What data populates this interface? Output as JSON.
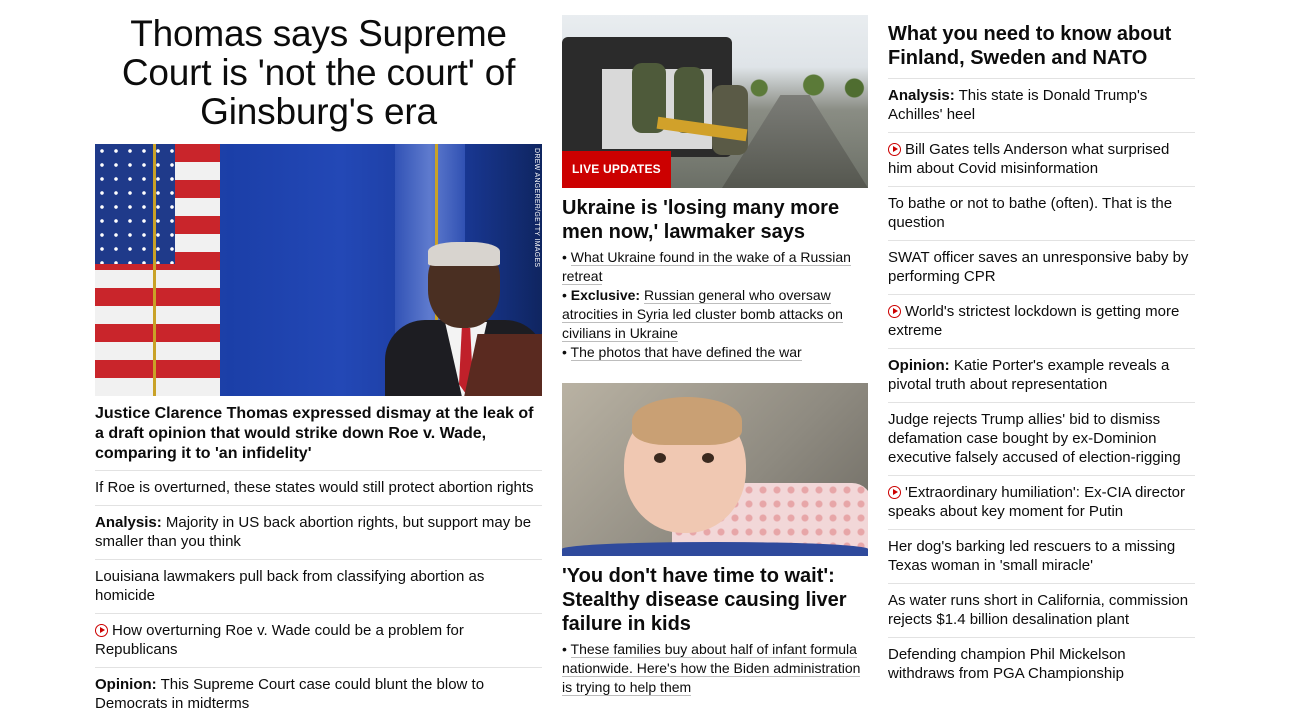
{
  "left": {
    "headline": "Thomas says Supreme Court is 'not the court' of Ginsburg's era",
    "image_credit": "DREW ANGERER/GETTY IMAGES",
    "caption": "Justice Clarence Thomas expressed dismay at the leak of a draft opinion that would strike down Roe v. Wade, comparing it to 'an infidelity'",
    "items": [
      {
        "prefix": "",
        "text": "If Roe is overturned, these states would still protect abortion rights"
      },
      {
        "prefix": "Analysis:",
        "text": "Majority in US back abortion rights, but support may be smaller than you think"
      },
      {
        "prefix": "",
        "text": "Louisiana lawmakers pull back from classifying abortion as homicide"
      },
      {
        "prefix": "",
        "text": "How overturning Roe v. Wade could be a problem for Republicans"
      },
      {
        "prefix": "Opinion:",
        "text": "This Supreme Court case could blunt the blow to Democrats in midterms"
      }
    ]
  },
  "middle": {
    "live_badge": "LIVE UPDATES",
    "story1": {
      "headline": "Ukraine is 'losing many more men now,' lawmaker says",
      "bullets": [
        {
          "prefix": "",
          "text": "What Ukraine found in the wake of a Russian retreat"
        },
        {
          "prefix": "Exclusive:",
          "text": "Russian general who oversaw atrocities in Syria led cluster bomb attacks on civilians in Ukraine"
        },
        {
          "prefix": "",
          "text": "The photos that have defined the war"
        }
      ]
    },
    "story2": {
      "headline": "'You don't have time to wait': Stealthy disease causing liver failure in kids",
      "bullets": [
        {
          "prefix": "",
          "text": "These families buy about half of infant formula nationwide. Here's how the Biden administration is trying to help them"
        }
      ]
    }
  },
  "right": {
    "headline": "What you need to know about Finland, Sweden and NATO",
    "items": [
      {
        "prefix": "Analysis:",
        "text": "This state is Donald Trump's Achilles' heel"
      },
      {
        "prefix": "",
        "text": "Bill Gates tells Anderson what surprised him about Covid misinformation"
      },
      {
        "prefix": "",
        "text": "To bathe or not to bathe (often). That is the question"
      },
      {
        "prefix": "",
        "text": "SWAT officer saves an unresponsive baby by performing CPR"
      },
      {
        "prefix": "",
        "text": "World's strictest lockdown is getting more extreme"
      },
      {
        "prefix": "Opinion:",
        "text": "Katie Porter's example reveals a pivotal truth about representation"
      },
      {
        "prefix": "",
        "text": "Judge rejects Trump allies' bid to dismiss defamation case bought by ex-Dominion executive falsely accused of election-rigging"
      },
      {
        "prefix": "",
        "text": "'Extraordinary humiliation': Ex-CIA director speaks about key moment for Putin"
      },
      {
        "prefix": "",
        "text": "Her dog's barking led rescuers to a missing Texas woman in 'small miracle'"
      },
      {
        "prefix": "",
        "text": "As water runs short in California, commission rejects $1.4 billion desalination plant"
      },
      {
        "prefix": "",
        "text": "Defending champion Phil Mickelson withdraws from PGA Championship"
      }
    ]
  },
  "colors": {
    "accent": "#cc0000",
    "text": "#0c0c0c",
    "divider": "#e2e2e2"
  }
}
